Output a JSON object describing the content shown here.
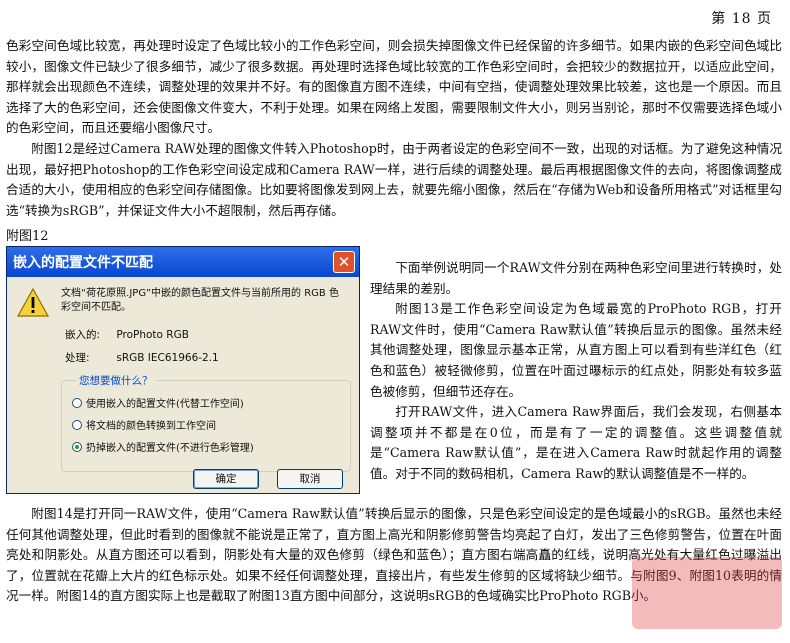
{
  "page_number": "第 18 页",
  "paragraphs_top": [
    "色彩空间色域比较宽，再处理时设定了色域比较小的工作色彩空间，则会损失掉图像文件已经保留的许多细节。如果内嵌的色彩空间色域比较小，图像文件已缺少了很多细节，减少了很多数据。再处理时选择色域比较宽的工作色彩空间时，会把较少的数据拉开，以适应此空间，那样就会出现颜色不连续，调整处理的效果并不好。有的图像直方图不连续，中间有空挡，使调整处理效果比较差，这也是一个原因。而且选择了大的色彩空间，还会使图像文件变大，不利于处理。如果在网络上发图，需要限制文件大小，则另当别论，那时不仅需要选择色域小的色彩空间，而且还要缩小图像尺寸。",
    "附图12是经过Camera RAW处理的图像文件转入Photoshop时，由于两者设定的色彩空间不一致，出现的对话框。为了避免这种情况出现，最好把Photoshop的工作色彩空间设定成和Camera RAW一样，进行后续的调整处理。最后再根据图像文件的去向，将图像调整成合适的大小，使用相应的色彩空间存储图像。比如要将图像发到网上去，就要先缩小图像，然后在“存储为Web和设备所用格式”对话框里勾选“转换为sRGB”，并保证文件大小不超限制，然后再存储。"
  ],
  "caption": "附图12",
  "dialog": {
    "title": "嵌入的配置文件不匹配",
    "close_glyph": "✕",
    "message": "文档“荷花原照.JPG”中嵌的颜色配置文件与当前所用的 RGB 色彩空间不匹配。",
    "embedded_label": "嵌入的:",
    "embedded_value": "ProPhoto RGB",
    "working_label": "处理:",
    "working_value": "sRGB IEC61966-2.1",
    "group_title": "您想要做什么？",
    "options": [
      {
        "label": "使用嵌入的配置文件(代替工作空间)",
        "selected": false
      },
      {
        "label": "将文档的颜色转换到工作空间",
        "selected": false
      },
      {
        "label": "扔掉嵌入的配置文件(不进行色彩管理)",
        "selected": true
      }
    ],
    "ok_label": "确定",
    "cancel_label": "取消"
  },
  "paragraphs_right": [
    "下面举例说明同一个RAW文件分别在两种色彩空间里进行转换时，处理结果的差别。",
    "附图13是工作色彩空间设定为色域最宽的ProPhoto RGB，打开RAW文件时，使用“Camera Raw默认值”转换后显示的图像。虽然未经其他调整处理，图像显示基本正常，从直方图上可以看到有些洋红色（红色和蓝色）被轻微修剪，位置在叶面过曝标示的红点处，阴影处有较多蓝色被修剪，但细节还存在。",
    "打开RAW文件，进入Camera Raw界面后，我们会发现，右侧基本调整项并不都是在0位，而是有了一定的调整值。这些调整值就是“Camera Raw默认值”，是在进入Camera Raw时就起作用的调整值。对于不同的数码相机，Camera Raw的默认调整值是不一样的。"
  ],
  "paragraph_bottom": "附图14是打开同一RAW文件，使用“Camera Raw默认值”转换后显示的图像，只是色彩空间设定的是色域最小的sRGB。虽然也未经任何其他调整处理，但此时看到的图像就不能说是正常了，直方图上高光和阴影修剪警告均亮起了白灯，发出了三色修剪警告，位置在叶面亮处和阴影处。从直方图还可以看到，阴影处有大量的双色修剪（绿色和蓝色）；直方图右端高矗的红线，说明高光处有大量红色过曝溢出了，位置就在花瓣上大片的红色标示处。如果不经任何调整处理，直接出片，有些发生修剪的区域将缺少细节。与附图9、附图10表明的情况一样。附图14的直方图实际上也是截取了附图13直方图中间部分，这说明sRGB的色域确实比ProPhoto RGB小。"
}
